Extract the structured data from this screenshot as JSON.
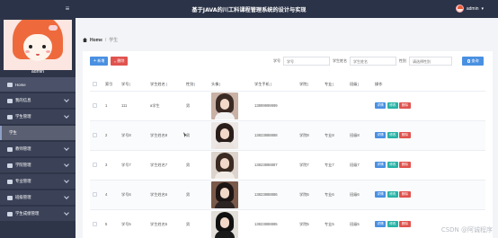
{
  "app": {
    "title": "基于JAVA的川工科课程管理系统的设计与实现",
    "user": "admin",
    "menu_toggle": "≡"
  },
  "sidebar": {
    "username": "admin",
    "items": [
      {
        "label": "Home",
        "icon": "home-icon",
        "chevron": false,
        "active": false
      },
      {
        "label": "我的信息",
        "icon": "user-icon",
        "chevron": true,
        "active": false
      },
      {
        "label": "学生管理",
        "icon": "students-icon",
        "chevron": true,
        "active": false
      },
      {
        "label": "学生",
        "icon": "",
        "chevron": false,
        "active": true
      },
      {
        "label": "教师管理",
        "icon": "teacher-icon",
        "chevron": true,
        "active": false
      },
      {
        "label": "学院管理",
        "icon": "college-icon",
        "chevron": true,
        "active": false
      },
      {
        "label": "专业管理",
        "icon": "major-icon",
        "chevron": true,
        "active": false
      },
      {
        "label": "班级管理",
        "icon": "class-icon",
        "chevron": true,
        "active": false
      },
      {
        "label": "学生成绩管理",
        "icon": "score-icon",
        "chevron": true,
        "active": false
      }
    ]
  },
  "breadcrumb": {
    "home": "Home",
    "separator": "/",
    "current": "学生"
  },
  "toolbar": {
    "add_label": "新增",
    "delete_label": "删除"
  },
  "search": {
    "fields": [
      {
        "label": "学号",
        "placeholder": "学号"
      },
      {
        "label": "学生姓名",
        "placeholder": "学生姓名"
      },
      {
        "label": "性别",
        "placeholder": "请选择性别"
      }
    ],
    "button_label": "查询"
  },
  "table": {
    "headers": [
      "",
      "索引",
      "学号",
      "学生姓名",
      "性别",
      "头像",
      "学生手机",
      "学院",
      "专业",
      "班级",
      "操作"
    ],
    "actions": [
      "详情",
      "修改",
      "删除"
    ],
    "rows": [
      {
        "index": "1",
        "id": "111",
        "name": "a学生",
        "gender": "男",
        "phone": "13899999999",
        "college": "",
        "major": "",
        "cls": "",
        "photo": "girl1"
      },
      {
        "index": "2",
        "id": "学号8",
        "name": "学生姓名8",
        "gender": "男",
        "phone": "13823888888",
        "college": "学院8",
        "major": "专业8",
        "cls": "班级8",
        "photo": "girl2"
      },
      {
        "index": "3",
        "id": "学号7",
        "name": "学生姓名7",
        "gender": "男",
        "phone": "13823888887",
        "college": "学院7",
        "major": "专业7",
        "cls": "班级7",
        "photo": "girl3"
      },
      {
        "index": "4",
        "id": "学号6",
        "name": "学生姓名6",
        "gender": "男",
        "phone": "13823888886",
        "college": "学院6",
        "major": "专业6",
        "cls": "班级6",
        "photo": "boy1"
      },
      {
        "index": "5",
        "id": "学号5",
        "name": "学生姓名5",
        "gender": "男",
        "phone": "13823888885",
        "college": "学院5",
        "major": "专业5",
        "cls": "班级5",
        "photo": "boy2"
      }
    ]
  },
  "watermark": "CSDN @阿诚程序",
  "colors": {
    "topbar": "#2b3348",
    "sidebar": "#2f3549",
    "primary": "#4a90e2",
    "danger": "#e0534f",
    "success": "#29b2a5"
  }
}
